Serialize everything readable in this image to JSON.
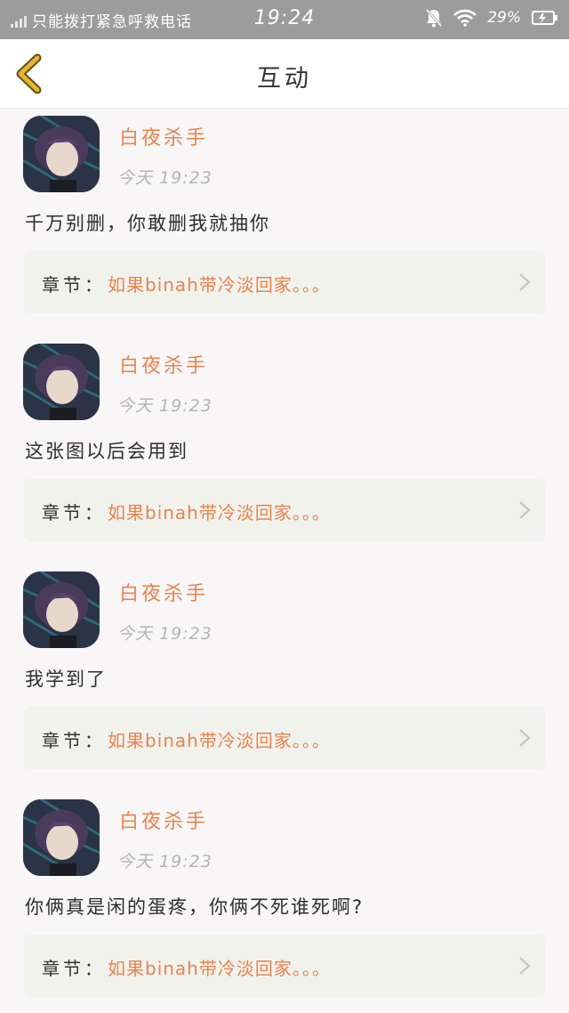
{
  "status_bar": {
    "carrier_text": "只能拨打紧急呼救电话",
    "time": "19:24",
    "battery_text": "29%",
    "icons": [
      "signal-icon",
      "mute-bell-icon",
      "wifi-icon",
      "battery-icon"
    ]
  },
  "nav": {
    "title": "互动",
    "back_icon": "chevron-left-icon",
    "accent_color": "#e8b42a"
  },
  "posts": [
    {
      "username": "白夜杀手",
      "time": "今天 19:23",
      "comment": "千万别删，你敢删我就抽你",
      "chapter_label": "章节：",
      "chapter_name": "如果binah带冷淡回家。。。"
    },
    {
      "username": "白夜杀手",
      "time": "今天 19:23",
      "comment": "这张图以后会用到",
      "chapter_label": "章节：",
      "chapter_name": "如果binah带冷淡回家。。。"
    },
    {
      "username": "白夜杀手",
      "time": "今天 19:23",
      "comment": "我学到了",
      "chapter_label": "章节：",
      "chapter_name": "如果binah带冷淡回家。。。"
    },
    {
      "username": "白夜杀手",
      "time": "今天 19:23",
      "comment": "你俩真是闲的蛋疼，你俩不死谁死啊?",
      "chapter_label": "章节：",
      "chapter_name": "如果binah带冷淡回家。。。"
    }
  ],
  "colors": {
    "username": "#e8834e",
    "chapter_name": "#e8834e",
    "status_bar": "#9c9c9c",
    "background": "#f8f6f6"
  }
}
